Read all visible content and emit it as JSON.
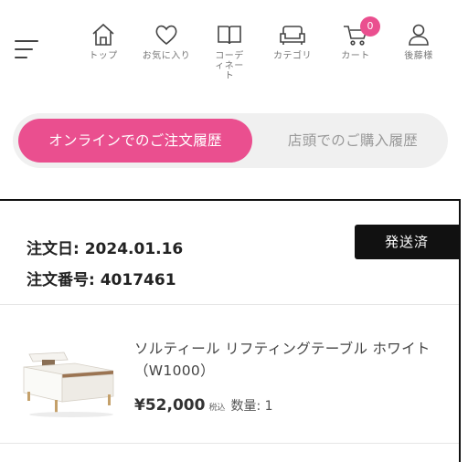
{
  "header": {
    "nav": [
      {
        "label": "トップ",
        "icon": "home-icon"
      },
      {
        "label": "お気に入り",
        "icon": "heart-icon"
      },
      {
        "label": "コーディネート",
        "icon": "book-icon"
      },
      {
        "label": "カテゴリ",
        "icon": "sofa-icon"
      },
      {
        "label": "カート",
        "icon": "cart-icon"
      },
      {
        "label": "後藤様",
        "icon": "user-icon"
      }
    ],
    "cart_count": "0",
    "accent_color": "#ea4f8f"
  },
  "tabs": {
    "online": "オンラインでのご注文履歴",
    "store": "店頭でのご購入履歴"
  },
  "order": {
    "date_label": "注文日: 2024.01.16",
    "number_label": "注文番号: 4017461",
    "status": "発送済",
    "item": {
      "name": "ソルティール リフティングテーブル ホワイト（W1000）",
      "price": "¥52,000",
      "tax_label": "税込",
      "quantity_label": "数量: 1"
    }
  }
}
